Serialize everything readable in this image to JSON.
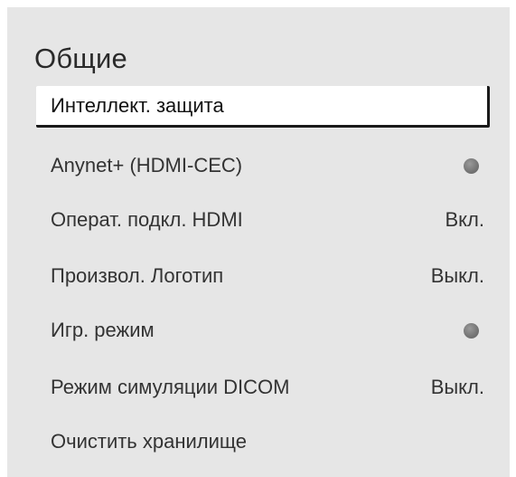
{
  "panel": {
    "title": "Общие"
  },
  "menu": {
    "items": [
      {
        "label": "Интеллект. защита",
        "value": ""
      },
      {
        "label": "Anynet+ (HDMI-CEC)",
        "value": ""
      },
      {
        "label": "Операт. подкл. HDMI",
        "value": "Вкл."
      },
      {
        "label": "Произвол. Логотип",
        "value": "Выкл."
      },
      {
        "label": "Игр. режим",
        "value": ""
      },
      {
        "label": "Режим симуляции DICOM",
        "value": "Выкл."
      },
      {
        "label": "Очистить хранилище",
        "value": ""
      }
    ]
  },
  "colors": {
    "panel_bg": "#e6e6e6",
    "selected_bg": "#ffffff",
    "toggle_off": "#777777"
  }
}
